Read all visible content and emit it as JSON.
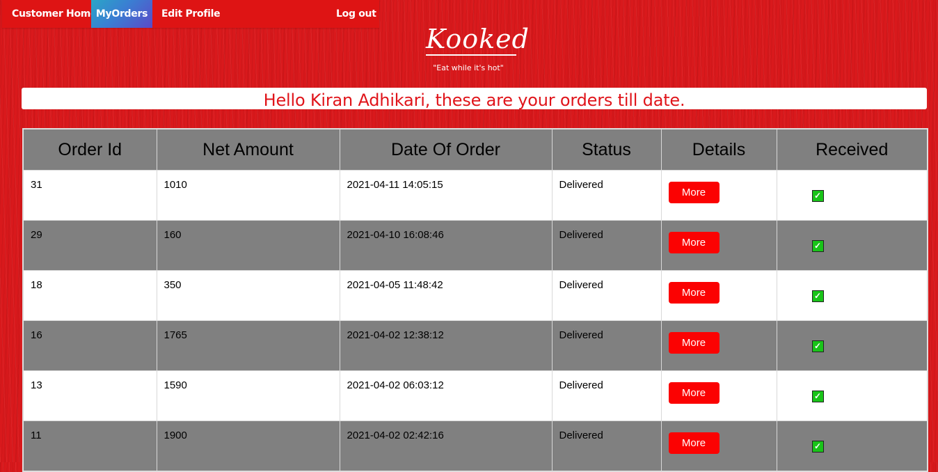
{
  "nav": {
    "home": "Customer Home",
    "orders": "MyOrders",
    "profile": "Edit Profile",
    "logout": "Log out"
  },
  "brand": {
    "logo": "Kooked",
    "tagline": "\"Eat while it's hot\""
  },
  "greeting": "Hello Kiran Adhikari, these are your orders till date.",
  "table": {
    "headers": [
      "Order Id",
      "Net Amount",
      "Date Of Order",
      "Status",
      "Details",
      "Received"
    ],
    "rows": [
      {
        "id": "31",
        "amount": "1010",
        "date": "2021-04-11 14:05:15",
        "status": "Delivered",
        "action": "More",
        "received": true
      },
      {
        "id": "29",
        "amount": "160",
        "date": "2021-04-10 16:08:46",
        "status": "Delivered",
        "action": "More",
        "received": true
      },
      {
        "id": "18",
        "amount": "350",
        "date": "2021-04-05 11:48:42",
        "status": "Delivered",
        "action": "More",
        "received": true
      },
      {
        "id": "16",
        "amount": "1765",
        "date": "2021-04-02 12:38:12",
        "status": "Delivered",
        "action": "More",
        "received": true
      },
      {
        "id": "13",
        "amount": "1590",
        "date": "2021-04-02 06:03:12",
        "status": "Delivered",
        "action": "More",
        "received": true
      },
      {
        "id": "11",
        "amount": "1900",
        "date": "2021-04-02 02:42:16",
        "status": "Delivered",
        "action": "More",
        "received": true
      }
    ]
  },
  "colors": {
    "background": "#d9191c",
    "accent": "#fb0202",
    "row_alt": "#808080",
    "greeting_text": "#e0141a"
  },
  "icons": {
    "received": "checkbox-checked-icon"
  }
}
